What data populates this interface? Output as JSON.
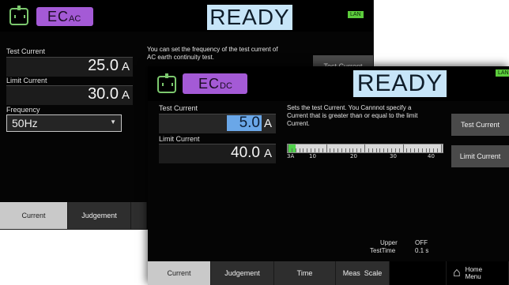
{
  "ac": {
    "mode_main": "EC",
    "mode_sub": "AC",
    "status": "READY",
    "lan": "LAN",
    "test_current_label": "Test Current",
    "test_current_value": "25.0",
    "test_current_unit": "A",
    "limit_current_label": "Limit Current",
    "limit_current_value": "30.0",
    "limit_current_unit": "A",
    "frequency_label": "Frequency",
    "frequency_value": "50Hz",
    "help_text": "You can set the frequency of the test current of AC earth continuity test.",
    "side_button": "Test Current",
    "tabs": [
      "Current",
      "Judgement"
    ]
  },
  "dc": {
    "mode_main": "EC",
    "mode_sub": "DC",
    "status": "READY",
    "lan": "LAN",
    "test_current_label": "Test Current",
    "test_current_value": "5.0",
    "test_current_unit": "A",
    "limit_current_label": "Limit Current",
    "limit_current_value": "40.0",
    "limit_current_unit": "A",
    "help_text": "Sets the test Current. You Cannnot specify a Current that is greater than or equal to the limit Current.",
    "scale_labels": [
      "3A",
      "10",
      "20",
      "30",
      "40"
    ],
    "scale_level_fraction": 0.03,
    "side_buttons": [
      "Test Current",
      "Limit Current"
    ],
    "upper_label": "Upper",
    "upper_value": "OFF",
    "testtime_label": "TestTime",
    "testtime_value": "0.1 s",
    "tabs": [
      "Current",
      "Judgement",
      "Time",
      "Meas  Scale"
    ],
    "home_label": "Home",
    "menu_label": "Menu"
  },
  "colors": {
    "mode_badge": "#a45ad6",
    "ready_bg": "#c7e5f8",
    "lan_bg": "#5ccc3c",
    "scale_fill": "#4fd14a",
    "highlight_value": "#6aa7e8"
  },
  "icons": [
    "plug-icon",
    "dropdown-arrow-icon",
    "home-icon"
  ]
}
